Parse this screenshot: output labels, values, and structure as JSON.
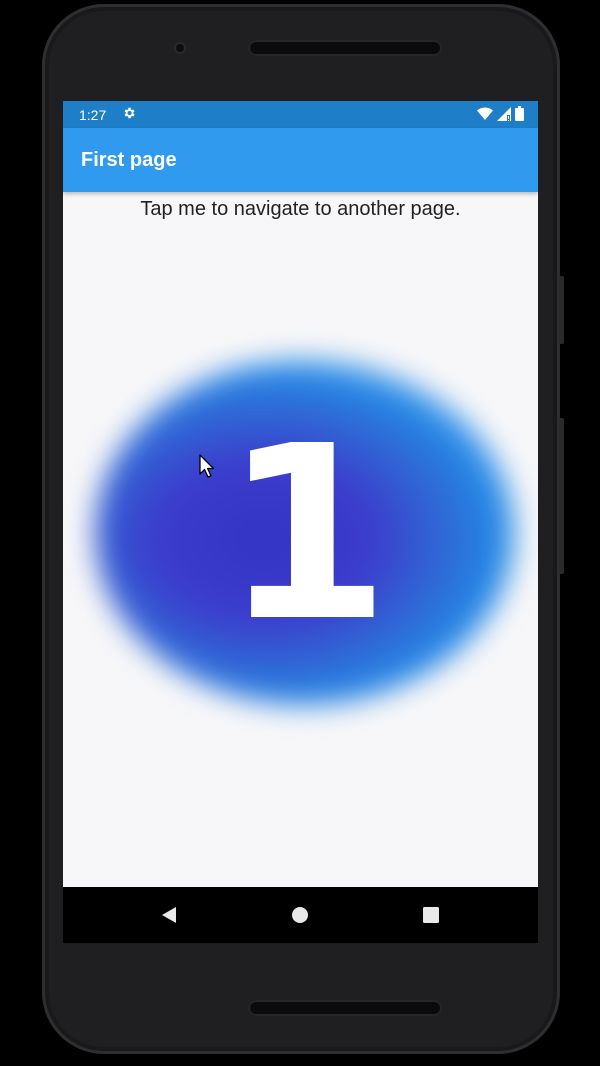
{
  "status_bar": {
    "time": "1:27",
    "icons": [
      "settings-icon",
      "wifi-icon",
      "signal-icon",
      "battery-icon"
    ]
  },
  "app_bar": {
    "title": "First page"
  },
  "content": {
    "tap_text": "Tap me to navigate to another page.",
    "big_number": "1"
  },
  "nav_bar": {
    "buttons": [
      "back-icon",
      "home-icon",
      "recents-icon"
    ]
  },
  "colors": {
    "status_bar": "#1e7fc8",
    "app_bar": "#2f9aee",
    "background": "#f7f7f9",
    "blob_inner": "#3434c4",
    "blob_outer": "#2388e6"
  }
}
